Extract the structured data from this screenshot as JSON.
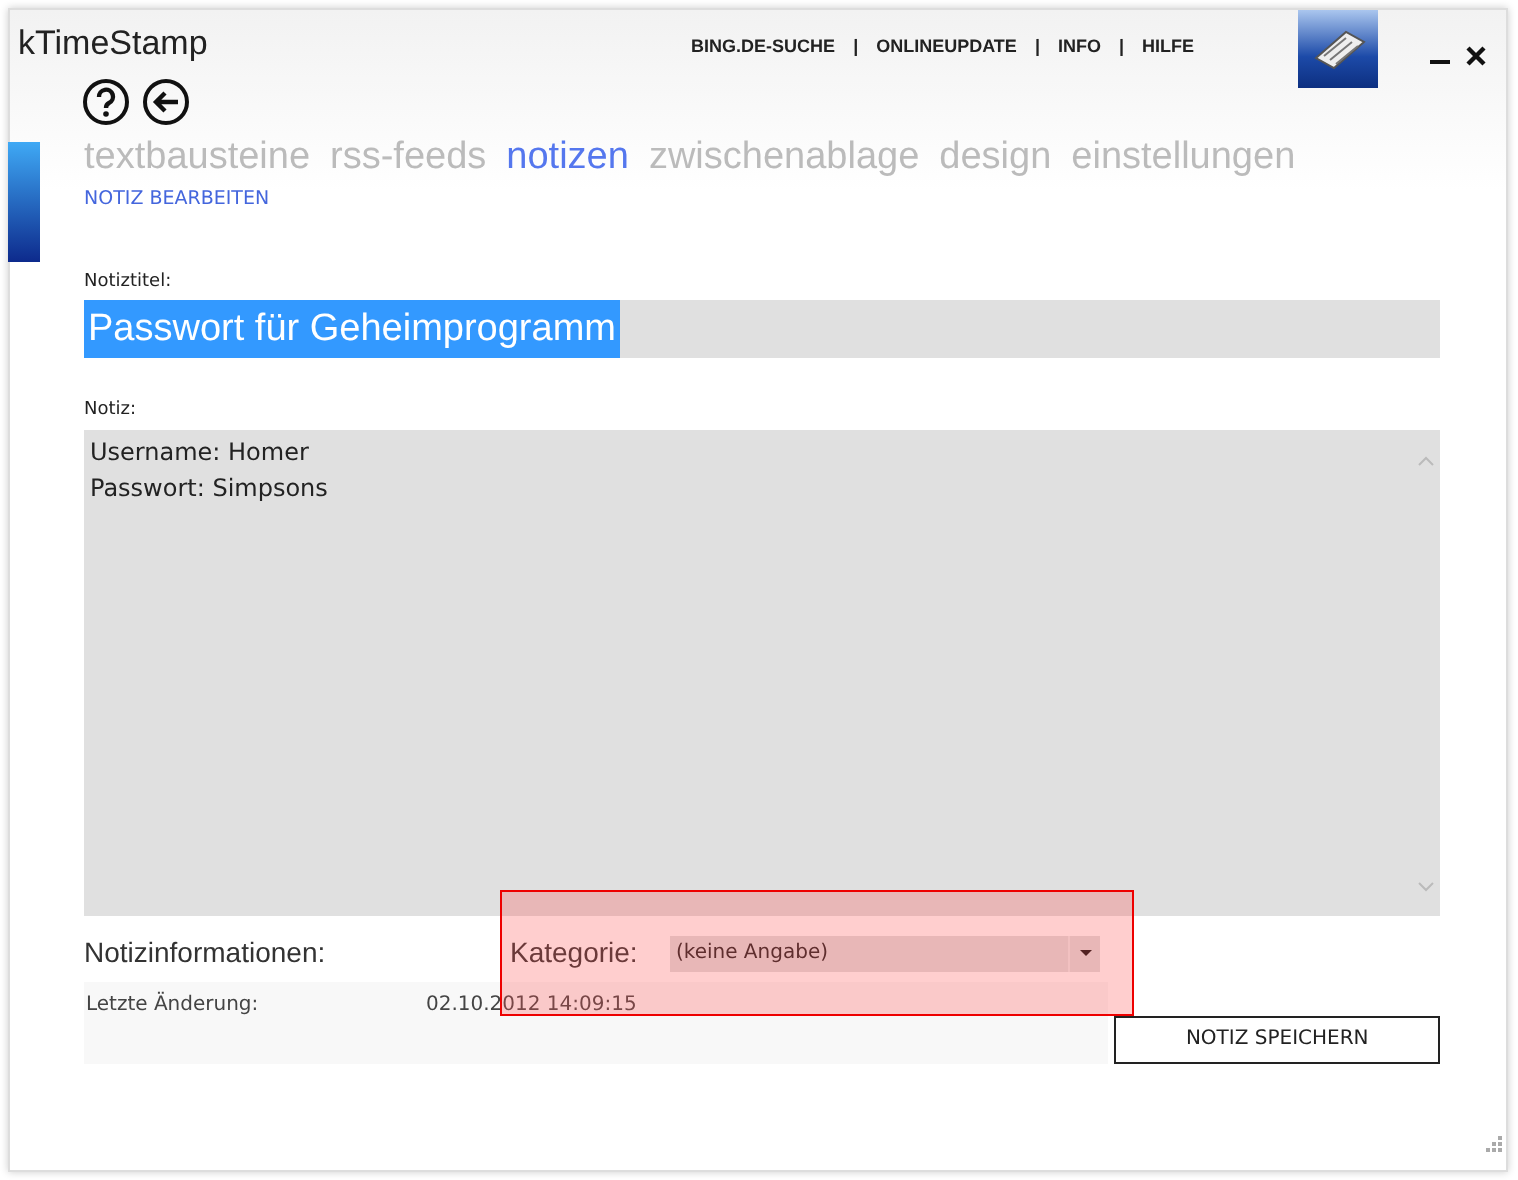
{
  "window": {
    "title": "kTimeStamp"
  },
  "top_links": [
    "BING.DE-SUCHE",
    "ONLINEUPDATE",
    "INFO",
    "HILFE"
  ],
  "separator": "|",
  "tabs": [
    {
      "label": "textbausteine",
      "selected": false
    },
    {
      "label": "rss-feeds",
      "selected": false
    },
    {
      "label": "notizen",
      "selected": true
    },
    {
      "label": "zwischenablage",
      "selected": false
    },
    {
      "label": "design",
      "selected": false
    },
    {
      "label": "einstellungen",
      "selected": false
    }
  ],
  "subtitle": "NOTIZ BEARBEITEN",
  "title_field": {
    "label": "Notiztitel:",
    "value": "Passwort für Geheimprogramm",
    "selected": true
  },
  "note_field": {
    "label": "Notiz:",
    "lines": [
      "Username: Homer",
      "Passwort: Simpsons"
    ]
  },
  "info": {
    "heading": "Notizinformationen:",
    "last_changed_label": "Letzte Änderung:",
    "last_changed_value": "02.10.2012 14:09:15"
  },
  "category": {
    "label": "Kategorie:",
    "value": "(keine Angabe)"
  },
  "highlight": {
    "visible": true
  },
  "save_button": "NOTIZ SPEICHERN"
}
